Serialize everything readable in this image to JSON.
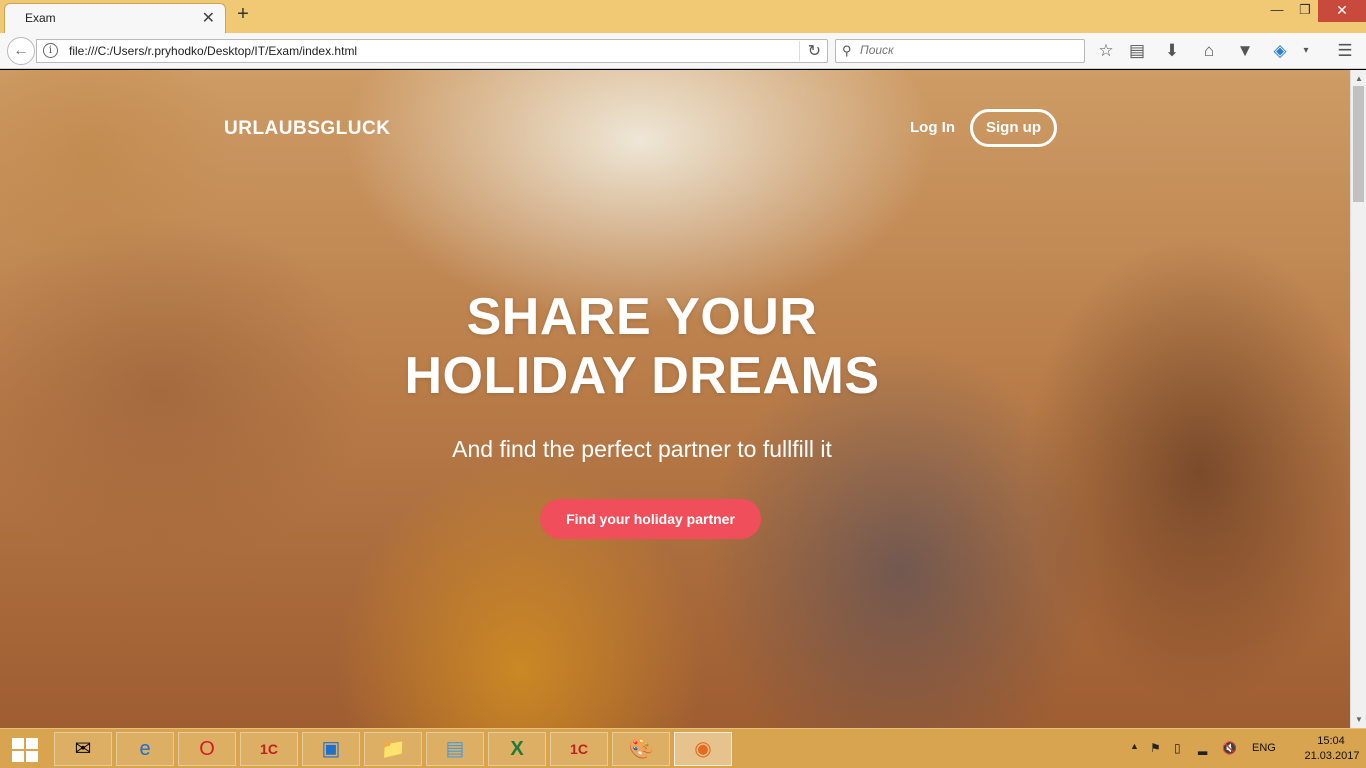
{
  "browser": {
    "tab_title": "Exam",
    "tab_close": "✕",
    "new_tab": "+",
    "url": "file:///C:/Users/r.pryhodko/Desktop/IT/Exam/index.html",
    "search_placeholder": "Поиск"
  },
  "page": {
    "logo": "URLAUBSGLUCK",
    "nav": {
      "login": "Log In",
      "signup": "Sign up"
    },
    "hero": {
      "title_line1": "SHARE YOUR",
      "title_line2": "HOLIDAY DREAMS",
      "subtitle": "And find the perfect partner to fullfill it",
      "cta": "Find your holiday partner"
    },
    "colors": {
      "cta": "#f04e5a",
      "taskbar": "#d9a450",
      "tabbar": "#f1c873"
    }
  },
  "taskbar": {
    "apps": [
      "outlook-icon",
      "internet-explorer-icon",
      "opera-icon",
      "1c-icon",
      "lync-icon",
      "file-explorer-icon",
      "notepad-icon",
      "excel-icon",
      "1c-icon",
      "paint-icon",
      "firefox-icon"
    ],
    "lang": "ENG",
    "time": "15:04",
    "date": "21.03.2017"
  }
}
